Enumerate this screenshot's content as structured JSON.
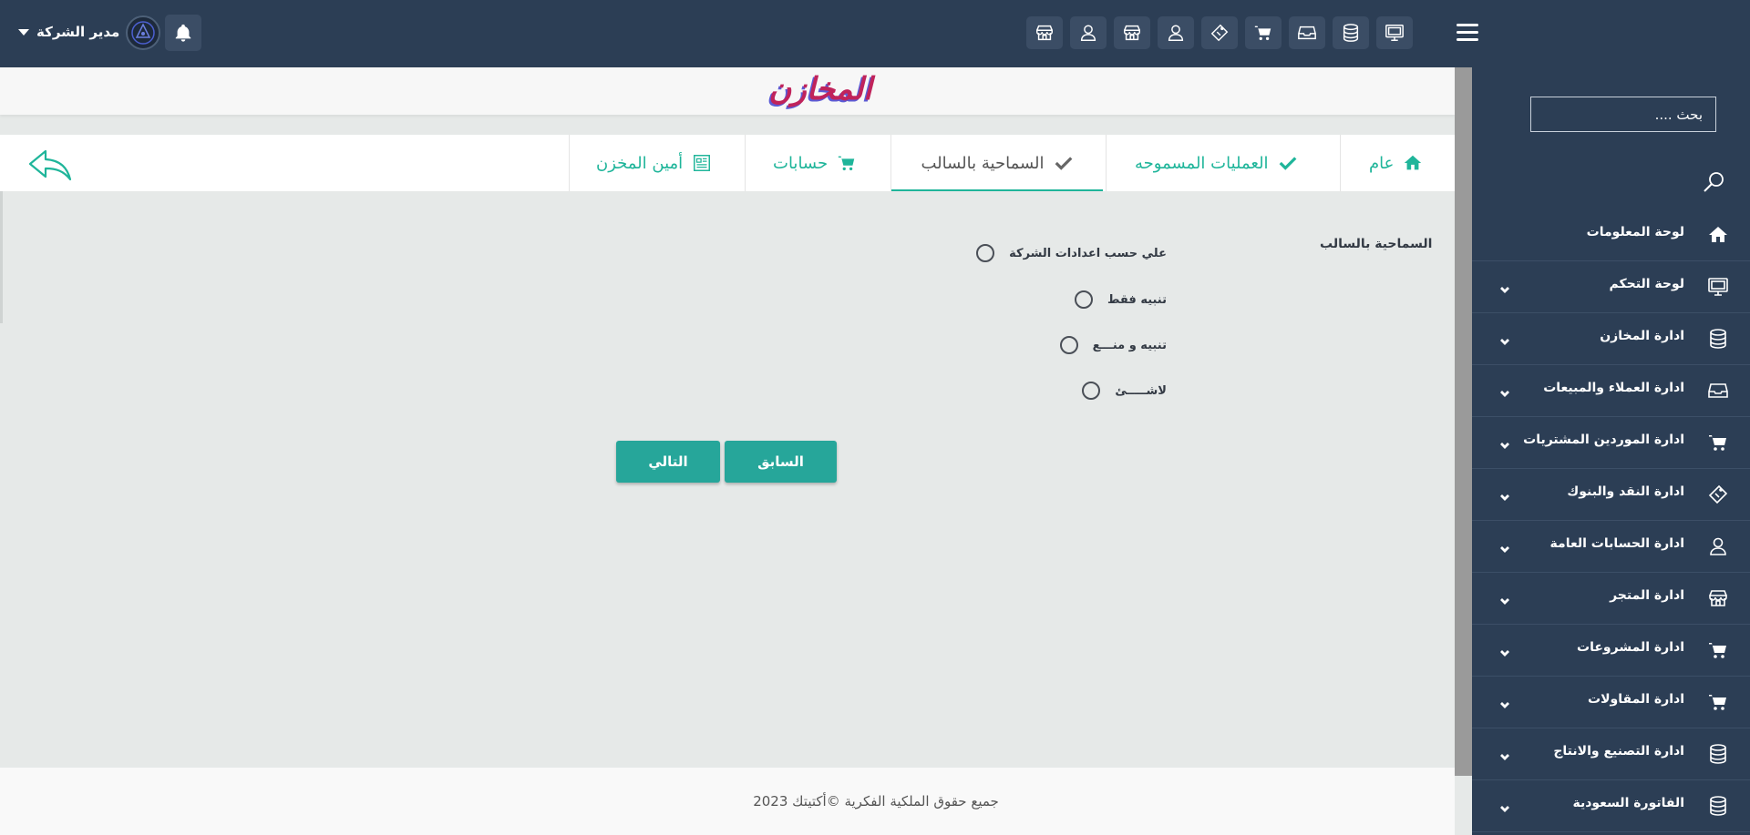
{
  "header": {
    "user_name": "مدير الشركة"
  },
  "sidebar": {
    "search_placeholder": "بحث ....",
    "items": [
      {
        "label": "لوحة المعلومات",
        "icon": "home-icon",
        "expandable": false
      },
      {
        "label": "لوحة التحكم",
        "icon": "monitor-icon",
        "expandable": true
      },
      {
        "label": "ادارة المخازن",
        "icon": "database-icon",
        "expandable": true
      },
      {
        "label": "ادارة العملاء والمبيعات",
        "icon": "inbox-icon",
        "expandable": true
      },
      {
        "label": "ادارة الموردين المشتريات",
        "icon": "cart-icon",
        "expandable": true
      },
      {
        "label": "ادارة النقد والبنوك",
        "icon": "ticket-icon",
        "expandable": true
      },
      {
        "label": "ادارة الحسابات العامة",
        "icon": "user-icon",
        "expandable": true
      },
      {
        "label": "ادارة المتجر",
        "icon": "store-icon",
        "expandable": true
      },
      {
        "label": "ادارة المشروعات",
        "icon": "cart-icon",
        "expandable": true
      },
      {
        "label": "ادارة المقاولات",
        "icon": "cart-icon",
        "expandable": true
      },
      {
        "label": "ادارة التصنيع والانتاج",
        "icon": "database-icon",
        "expandable": true
      },
      {
        "label": "الفاتورة السعودية",
        "icon": "database-icon",
        "expandable": true
      }
    ]
  },
  "page": {
    "title": "المخازن"
  },
  "tabs": [
    {
      "label": "عام",
      "icon": "home-icon"
    },
    {
      "label": "العمليات المسموحه",
      "icon": "check-icon"
    },
    {
      "label": "السماحية بالسالب",
      "icon": "check-icon",
      "active": true
    },
    {
      "label": "حسابات",
      "icon": "cart-icon"
    },
    {
      "label": "أمين المخزن",
      "icon": "document-icon"
    }
  ],
  "form": {
    "label": "السماحية بالسالب",
    "options": [
      "علي حسب اعدادات الشركة",
      "تنبيه فقط",
      "تنبيه و منـــع",
      "لاشـــــئ"
    ],
    "prev_button": "السابق",
    "next_button": "التالي"
  },
  "footer": {
    "copyright": "جميع حقوق الملكية الفكرية ©أكتيتك 2023"
  },
  "colors": {
    "header_bg": "#2c3e55",
    "accent": "#26a69a",
    "tab_text": "#1fb59a",
    "title": "#c0235b"
  }
}
